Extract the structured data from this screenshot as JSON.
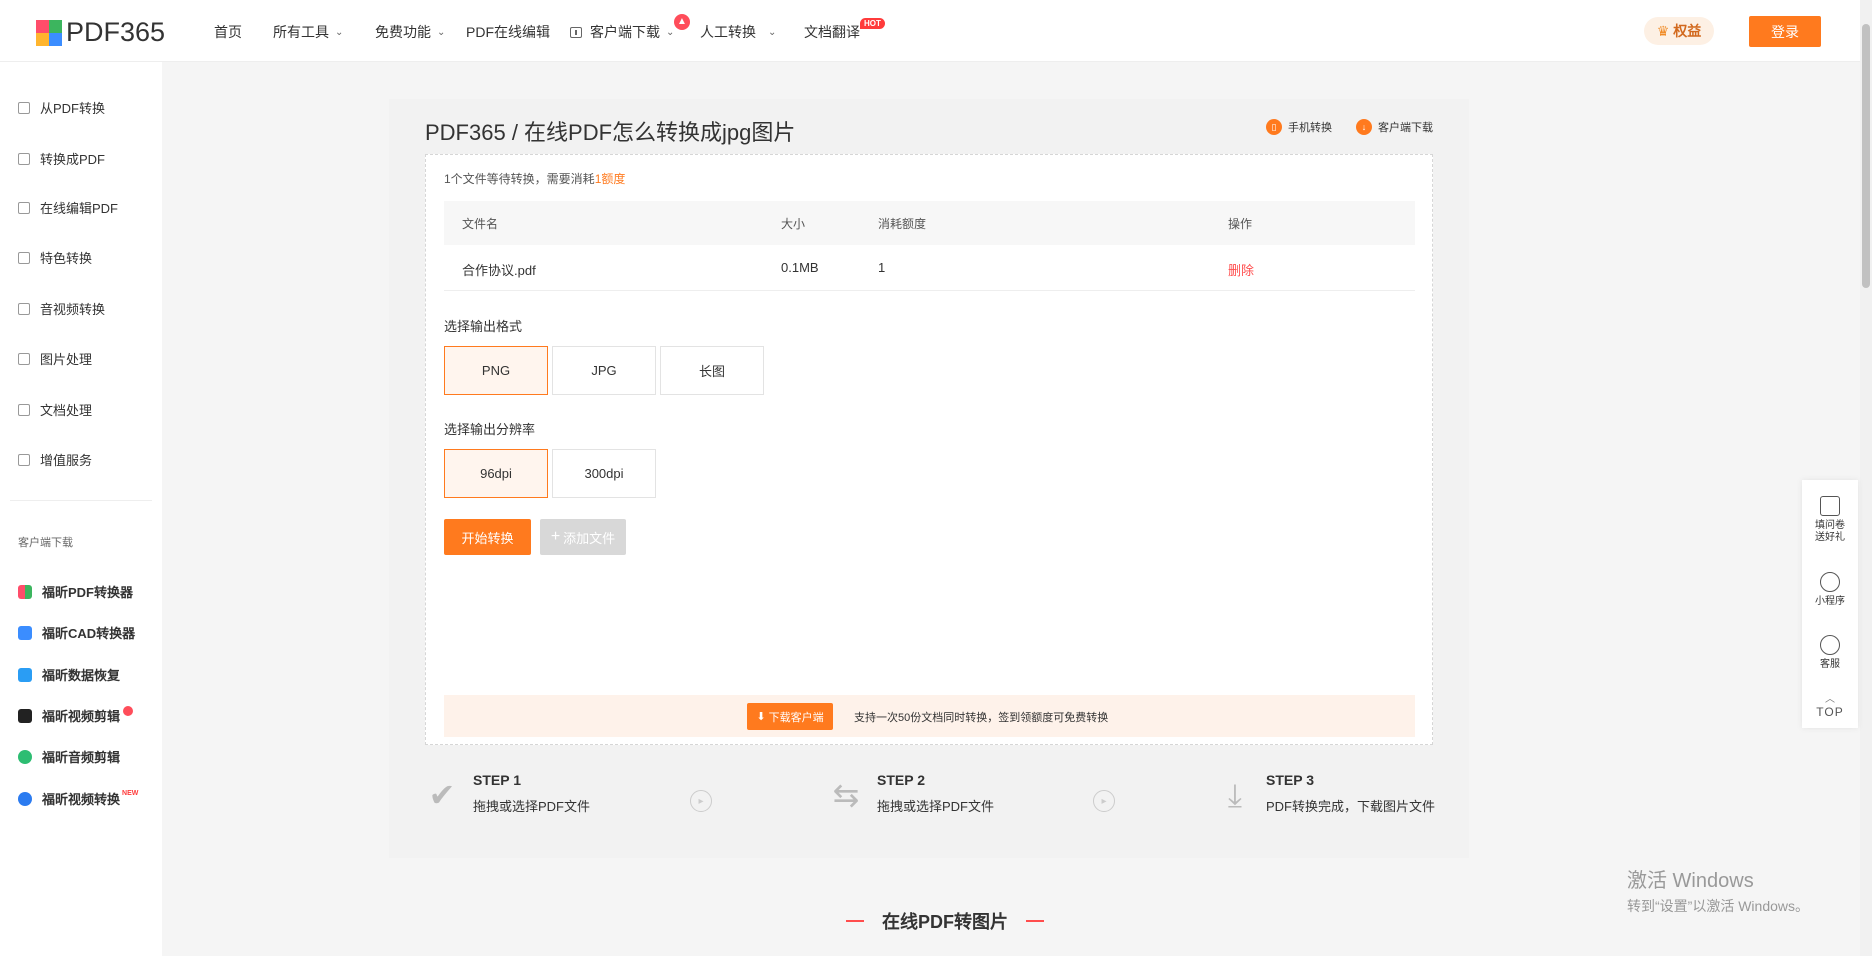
{
  "header": {
    "logo": "PDF365",
    "nav": [
      {
        "label": "首页"
      },
      {
        "label": "所有工具"
      },
      {
        "label": "免费功能"
      },
      {
        "label": "PDF在线编辑"
      },
      {
        "label": "客户端下载"
      },
      {
        "label": "人工转换"
      },
      {
        "label": "文档翻译"
      }
    ],
    "hot_badge": "HOT",
    "benefits": "权益",
    "login": "登录"
  },
  "sidebar": {
    "items": [
      {
        "label": "从PDF转换"
      },
      {
        "label": "转换成PDF"
      },
      {
        "label": "在线编辑PDF"
      },
      {
        "label": "特色转换"
      },
      {
        "label": "音视频转换"
      },
      {
        "label": "图片处理"
      },
      {
        "label": "文档处理"
      },
      {
        "label": "增值服务"
      }
    ],
    "download_label": "客户端下载",
    "apps": [
      {
        "label": "福昕PDF转换器",
        "color": "#3cb55e"
      },
      {
        "label": "福昕CAD转换器",
        "color": "#3b8dff"
      },
      {
        "label": "福昕数据恢复",
        "color": "#2a9df4"
      },
      {
        "label": "福昕视频剪辑",
        "color": "#222222"
      },
      {
        "label": "福昕音频剪辑",
        "color": "#2dbd72"
      },
      {
        "label": "福昕视频转换",
        "color": "#2b7bf0"
      }
    ],
    "new_badge": "NEW"
  },
  "main": {
    "title": "PDF365 / 在线PDF怎么转换成jpg图片",
    "mobile_convert": "手机转换",
    "client_download": "客户端下载",
    "wait_text": "1个文件等待转换，需要消耗",
    "wait_amount": "1额度",
    "table": {
      "headers": [
        "文件名",
        "大小",
        "消耗额度",
        "操作"
      ],
      "rows": [
        {
          "name": "合作协议.pdf",
          "size": "0.1MB",
          "cost": "1",
          "action": "删除"
        }
      ]
    },
    "format_label": "选择输出格式",
    "formats": [
      "PNG",
      "JPG",
      "长图"
    ],
    "resolution_label": "选择输出分辨率",
    "resolutions": [
      "96dpi",
      "300dpi"
    ],
    "start_button": "开始转换",
    "add_button": "添加文件",
    "promo": {
      "button": "下载客户端",
      "text": "支持一次50份文档同时转换，签到领额度可免费转换"
    },
    "steps": [
      {
        "title": "STEP 1",
        "desc": "拖拽或选择PDF文件"
      },
      {
        "title": "STEP 2",
        "desc": "拖拽或选择PDF文件"
      },
      {
        "title": "STEP 3",
        "desc": "PDF转换完成，下载图片文件"
      }
    ]
  },
  "float_tool": {
    "survey_line1": "填问卷",
    "survey_line2": "送好礼",
    "mini": "小程序",
    "service": "客服",
    "top": "TOP"
  },
  "watermark": {
    "line1": "激活 Windows",
    "line2": "转到“设置”以激活 Windows。"
  },
  "section_title": "在线PDF转图片"
}
